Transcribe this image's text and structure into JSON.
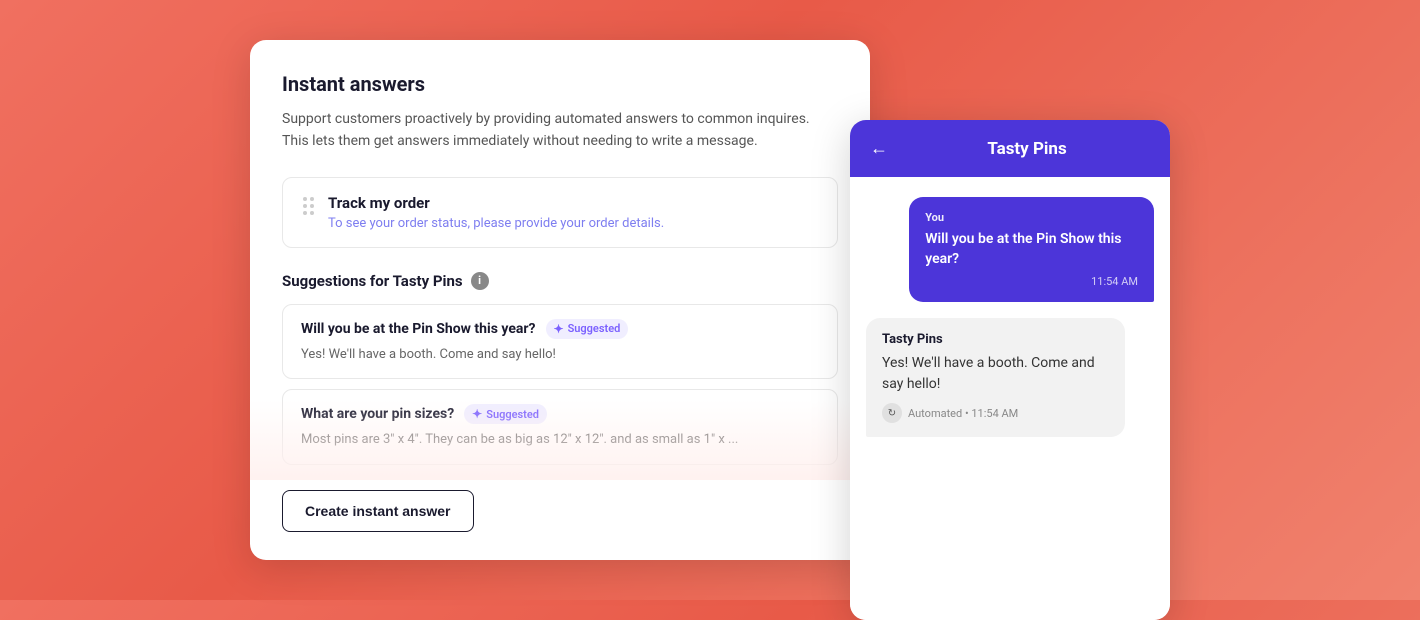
{
  "main_card": {
    "title": "Instant answers",
    "description": "Support customers proactively by providing automated answers to common inquires. This lets them get answers immediately without needing to write a message.",
    "track_order": {
      "title": "Track my order",
      "subtitle": "To see your order status, please provide your order details."
    },
    "suggestions_section": {
      "title": "Suggestions for Tasty Pins",
      "info_icon_label": "i",
      "items": [
        {
          "title": "Will you be at the Pin Show this year?",
          "badge": "Suggested",
          "text": "Yes! We'll have a booth. Come and say hello!"
        },
        {
          "title": "What are your pin sizes?",
          "badge": "Suggested",
          "text": "Most pins are 3\" x 4\". They can be as big as 12\" x 12\". and as small as 1\" x ..."
        }
      ]
    },
    "create_button_label": "Create instant answer"
  },
  "chat_panel": {
    "header_title": "Tasty Pins",
    "back_arrow": "←",
    "user_message": {
      "label": "You",
      "text": "Will you be at the Pin Show this year?",
      "time": "11:54 AM"
    },
    "bot_message": {
      "sender": "Tasty Pins",
      "text": "Yes! We'll have a booth. Come and say hello!",
      "footer": "Automated • 11:54 AM",
      "refresh_icon": "↻"
    }
  }
}
